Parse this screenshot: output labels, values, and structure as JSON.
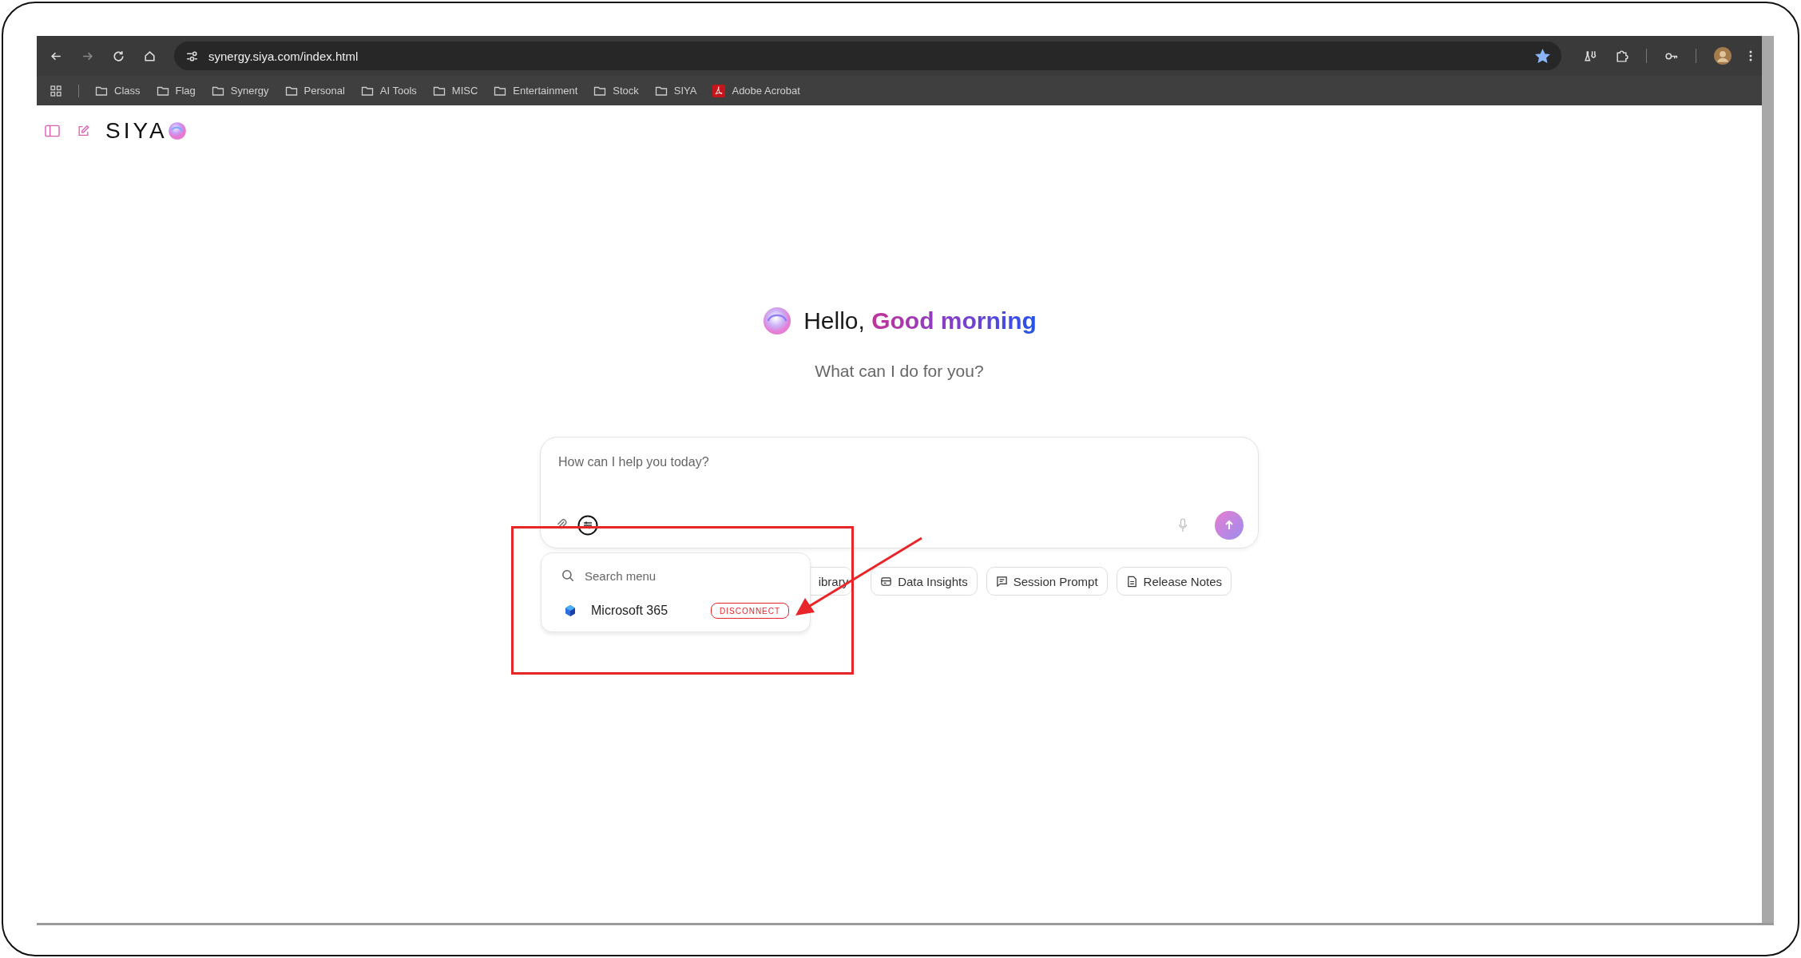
{
  "browser": {
    "url": "synergy.siya.com/index.html",
    "bookmarked": true,
    "bookmarks": [
      {
        "label": "Class",
        "kind": "folder"
      },
      {
        "label": "Flag",
        "kind": "folder"
      },
      {
        "label": "Synergy",
        "kind": "folder"
      },
      {
        "label": "Personal",
        "kind": "folder"
      },
      {
        "label": "AI Tools",
        "kind": "folder"
      },
      {
        "label": "MISC",
        "kind": "folder"
      },
      {
        "label": "Entertainment",
        "kind": "folder"
      },
      {
        "label": "Stock",
        "kind": "folder"
      },
      {
        "label": "SIYA",
        "kind": "folder"
      },
      {
        "label": "Adobe Acrobat",
        "kind": "pdf"
      }
    ]
  },
  "app": {
    "logo": "SIYA",
    "greeting": {
      "hello": "Hello,",
      "highlight": "Good morning"
    },
    "subtitle": "What can I do for you?",
    "prompt": {
      "placeholder": "How can I help you today?"
    },
    "chips": [
      {
        "label": "ibrary",
        "kind": "library"
      },
      {
        "label": "Data Insights",
        "kind": "insights"
      },
      {
        "label": "Session Prompt",
        "kind": "prompt"
      },
      {
        "label": "Release Notes",
        "kind": "notes"
      }
    ],
    "menu": {
      "search_placeholder": "Search menu",
      "items": [
        {
          "label": "Microsoft 365",
          "action": "DISCONNECT"
        }
      ]
    }
  }
}
